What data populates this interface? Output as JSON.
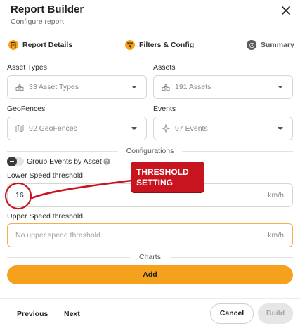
{
  "header": {
    "title": "Report Builder",
    "subtitle": "Configure report"
  },
  "steps": [
    {
      "label": "Report Details",
      "icon": "document-icon",
      "color": "#f5a11e"
    },
    {
      "label": "Filters & Config",
      "icon": "filter-icon",
      "color": "#f5a11e"
    },
    {
      "label": "Summary",
      "icon": "check-circle-icon",
      "color": "#5a5a5a"
    }
  ],
  "fields": {
    "asset_types": {
      "label": "Asset Types",
      "value": "33 Asset Types"
    },
    "assets": {
      "label": "Assets",
      "value": "191 Assets"
    },
    "geofences": {
      "label": "GeoFences",
      "value": "92 GeoFences"
    },
    "events": {
      "label": "Events",
      "value": "97 Events"
    }
  },
  "configurations": {
    "title": "Configurations",
    "group_events": {
      "label": "Group Events by Asset",
      "enabled": false
    },
    "lower_speed": {
      "label": "Lower Speed threshold",
      "value": "16",
      "unit": "km/h"
    },
    "upper_speed": {
      "label": "Upper Speed threshold",
      "placeholder": "No upper speed threshold",
      "unit": "km/h"
    }
  },
  "charts": {
    "title": "Charts",
    "add_label": "Add"
  },
  "footer": {
    "previous": "Previous",
    "next": "Next",
    "cancel": "Cancel",
    "build": "Build"
  },
  "annotation": {
    "line1": "THRESHOLD",
    "line2": "SETTING"
  },
  "colors": {
    "accent": "#f5a11e",
    "annotation_red": "#c8141e"
  }
}
